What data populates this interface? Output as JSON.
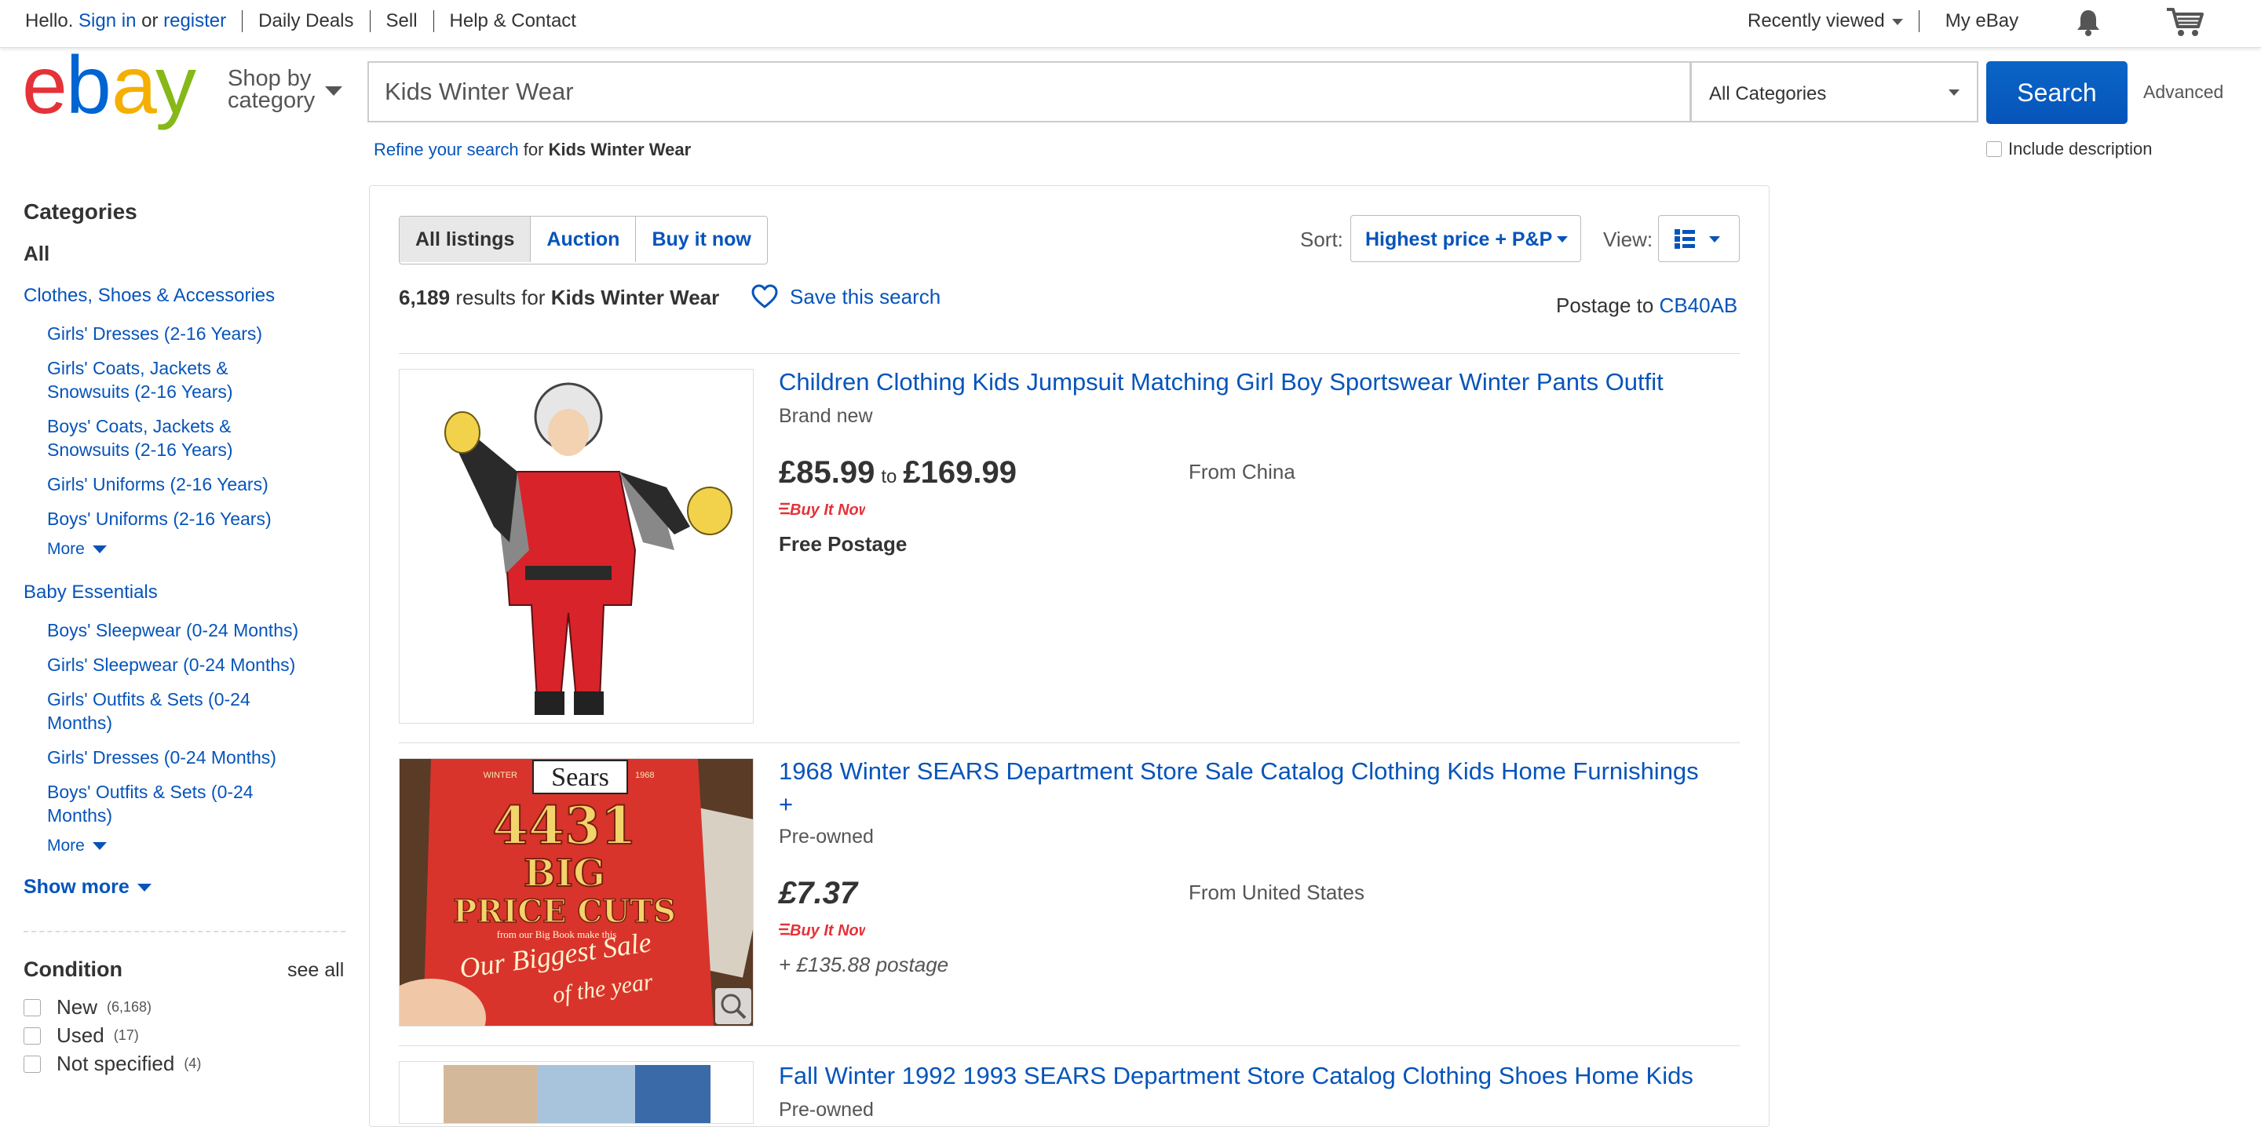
{
  "topbar": {
    "hello": "Hello.",
    "sign_in": "Sign in",
    "or": "or",
    "register": "register",
    "daily_deals": "Daily Deals",
    "sell": "Sell",
    "help_contact": "Help & Contact",
    "recently_viewed": "Recently viewed",
    "my_ebay": "My eBay"
  },
  "header": {
    "logo_letters": [
      "e",
      "b",
      "a",
      "y"
    ],
    "logo_colors": [
      "#e53238",
      "#0064d2",
      "#f5af02",
      "#86b817"
    ],
    "shop_by_line1": "Shop by",
    "shop_by_line2": "category",
    "search_value": "Kids Winter Wear",
    "category_select": "All Categories",
    "search_button": "Search",
    "advanced": "Advanced",
    "refine_link": "Refine your search",
    "refine_for": "for",
    "refine_query": "Kids Winter Wear",
    "include_description": "Include description"
  },
  "sidebar": {
    "categories_heading": "Categories",
    "all": "All",
    "group1": {
      "title": "Clothes, Shoes & Accessories",
      "items": [
        "Girls' Dresses (2-16 Years)",
        "Girls' Coats, Jackets &",
        "Snowsuits (2-16 Years)",
        "Boys' Coats, Jackets &",
        "Snowsuits (2-16 Years)",
        "Girls' Uniforms (2-16 Years)",
        "Boys' Uniforms (2-16 Years)"
      ],
      "more": "More"
    },
    "group2": {
      "title": "Baby Essentials",
      "items": [
        "Boys' Sleepwear (0-24 Months)",
        "Girls' Sleepwear (0-24 Months)",
        "Girls' Outfits & Sets (0-24",
        "Months)",
        "Girls' Dresses (0-24 Months)",
        "Boys' Outfits & Sets (0-24",
        "Months)"
      ],
      "more": "More"
    },
    "show_more": "Show more",
    "condition": {
      "heading": "Condition",
      "see_all": "see all",
      "options": [
        {
          "label": "New",
          "count": "(6,168)"
        },
        {
          "label": "Used",
          "count": "(17)"
        },
        {
          "label": "Not specified",
          "count": "(4)"
        }
      ]
    }
  },
  "results": {
    "tabs": [
      "All listings",
      "Auction",
      "Buy it now"
    ],
    "sort_label": "Sort:",
    "sort_value": "Highest price + P&P",
    "view_label": "View:",
    "count": "6,189",
    "results_for": "results for",
    "query": "Kids Winter Wear",
    "save_search": "Save this search",
    "postage_to": "Postage to",
    "postcode": "CB40AB",
    "items": [
      {
        "title": "Children Clothing Kids Jumpsuit Matching Girl Boy Sportswear Winter Pants Outfit",
        "condition": "Brand new",
        "price_low": "£85.99",
        "price_to": "to",
        "price_high": "£169.99",
        "buy_it_now": "Buy It Now",
        "shipping": "Free Postage",
        "from": "From China"
      },
      {
        "title_line1": "1968 Winter SEARS Department Store Sale Catalog Clothing Kids Home Furnishings",
        "title_line2": "+",
        "condition": "Pre-owned",
        "price": "£7.37",
        "buy_it_now": "Buy It Now",
        "shipping": "+ £135.88 postage",
        "from": "From United States",
        "image_text": {
          "brand": "Sears",
          "season": "WINTER",
          "year": "1968",
          "big_number": "4431",
          "line_big": "BIG",
          "line_price_cuts": "PRICE CUTS",
          "line_from": "from our Big Book make this",
          "line_our": "Our Biggest Sale",
          "line_year": "of the year"
        }
      },
      {
        "title": "Fall Winter 1992 1993 SEARS Department Store Catalog Clothing Shoes Home Kids",
        "condition": "Pre-owned"
      }
    ]
  }
}
